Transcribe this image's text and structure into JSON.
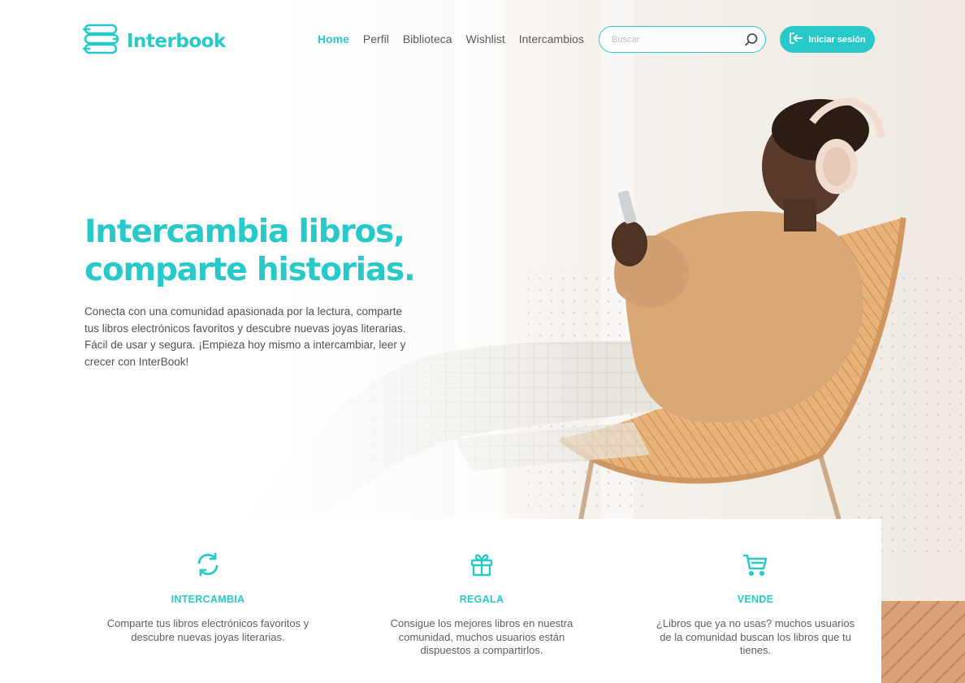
{
  "brand": {
    "name": "Interbook",
    "accent_color": "#2ac9c9"
  },
  "nav": {
    "items": [
      {
        "label": "Home",
        "active": true
      },
      {
        "label": "Perfil",
        "active": false
      },
      {
        "label": "Biblioteca",
        "active": false
      },
      {
        "label": "Wishlist",
        "active": false
      },
      {
        "label": "Intercambios",
        "active": false
      }
    ]
  },
  "search": {
    "placeholder": "Buscar",
    "value": "",
    "icon": "search-icon"
  },
  "login": {
    "label": "Iniciar sesión",
    "icon": "login-icon"
  },
  "hero": {
    "title_line1": "Intercambia libros,",
    "title_line2": "comparte historias.",
    "description": "Conecta con una comunidad apasionada por la lectura, comparte tus libros electrónicos favoritos y descubre nuevas joyas literarias. Fácil de usar y segura. ¡Empieza hoy mismo a intercambiar, leer y crecer con InterBook!",
    "image": "man-with-headphones-reading-tablet-in-chair"
  },
  "features": [
    {
      "icon": "refresh-icon",
      "title": "INTERCAMBIA",
      "description": "Comparte tus libros electrónicos favoritos y descubre nuevas joyas literarias."
    },
    {
      "icon": "gift-icon",
      "title": "REGALA",
      "description": "Consigue los mejores libros en nuestra comunidad, muchos usuarios están dispuestos a compartirlos."
    },
    {
      "icon": "cart-icon",
      "title": "VENDE",
      "description": "¿Libros que ya no usas? muchos usuarios de la comunidad buscan los libros que tu tienes."
    }
  ]
}
